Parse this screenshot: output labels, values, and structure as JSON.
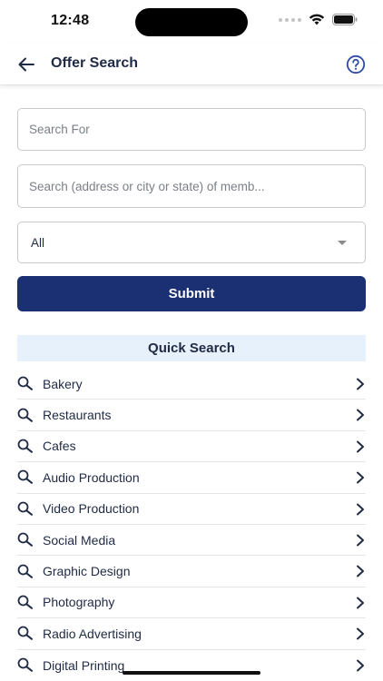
{
  "status_bar": {
    "time": "12:48"
  },
  "header": {
    "title": "Offer Search",
    "back_icon": "arrow-left-icon",
    "help_icon": "question-circle-icon"
  },
  "form": {
    "search_for_placeholder": "Search For",
    "search_address_placeholder": "Search (address or city or state) of memb...",
    "category_select_value": "All",
    "submit_label": "Submit"
  },
  "quick_search": {
    "title": "Quick Search",
    "items": [
      {
        "label": "Bakery"
      },
      {
        "label": "Restaurants"
      },
      {
        "label": "Cafes"
      },
      {
        "label": "Audio Production"
      },
      {
        "label": "Video Production"
      },
      {
        "label": "Social Media"
      },
      {
        "label": "Graphic Design"
      },
      {
        "label": "Photography"
      },
      {
        "label": "Radio Advertising"
      },
      {
        "label": "Digital Printing"
      }
    ]
  },
  "colors": {
    "primary": "#1b2f73",
    "header_text": "#1f2a44",
    "quick_search_bg": "#e6f1fb",
    "help_icon": "#2f4aa8"
  }
}
